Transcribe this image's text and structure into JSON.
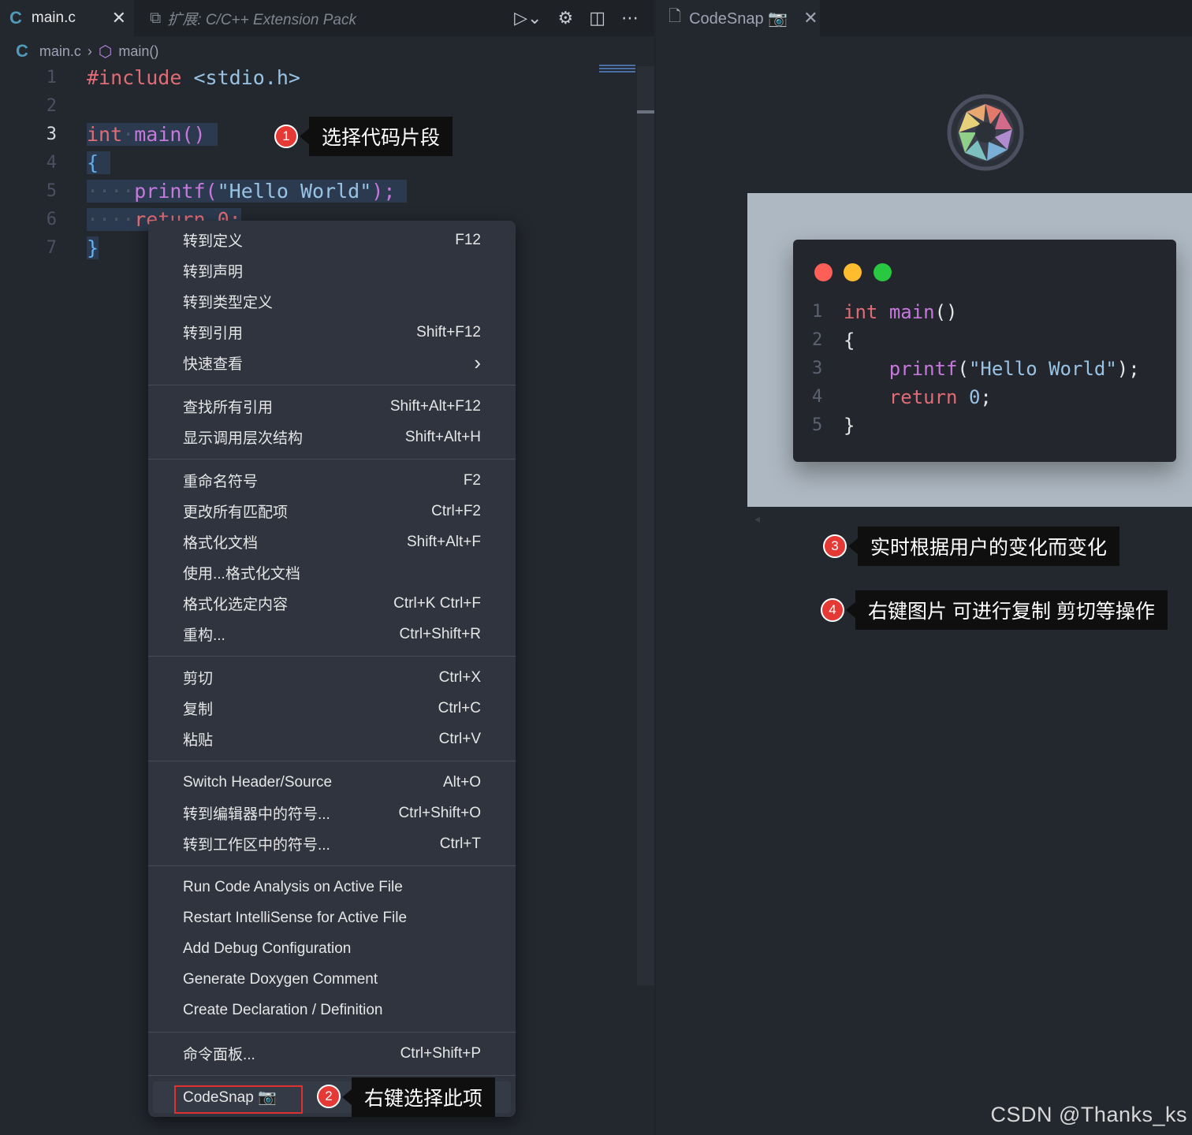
{
  "editor": {
    "tabs": [
      {
        "label": "main.c",
        "icon": "c-file-icon"
      },
      {
        "label": "扩展: C/C++ Extension Pack",
        "icon": "extensions-icon"
      }
    ],
    "breadcrumb": {
      "file": "main.c",
      "symbol": "main()"
    },
    "line_numbers": [
      "1",
      "2",
      "3",
      "4",
      "5",
      "6",
      "7"
    ],
    "code": {
      "l1_directive": "#include",
      "l1_header": "<stdio.h>",
      "l3_type": "int",
      "l3_name": "main()",
      "l4_open": "{",
      "l5_indent": "····",
      "l5_fn": "printf",
      "l5_paren_open": "(",
      "l5_str": "\"Hello World\"",
      "l5_end": ");",
      "l6_indent": "····",
      "l6_text": "return 0;",
      "l7_close": "}"
    }
  },
  "context_menu": {
    "groups": [
      [
        {
          "label": "转到定义",
          "shortcut": "F12"
        },
        {
          "label": "转到声明",
          "shortcut": ""
        },
        {
          "label": "转到类型定义",
          "shortcut": ""
        },
        {
          "label": "转到引用",
          "shortcut": "Shift+F12"
        },
        {
          "label": "快速查看",
          "shortcut": "›"
        }
      ],
      [
        {
          "label": "查找所有引用",
          "shortcut": "Shift+Alt+F12"
        },
        {
          "label": "显示调用层次结构",
          "shortcut": "Shift+Alt+H"
        }
      ],
      [
        {
          "label": "重命名符号",
          "shortcut": "F2"
        },
        {
          "label": "更改所有匹配项",
          "shortcut": "Ctrl+F2"
        },
        {
          "label": "格式化文档",
          "shortcut": "Shift+Alt+F"
        },
        {
          "label": "使用...格式化文档",
          "shortcut": ""
        },
        {
          "label": "格式化选定内容",
          "shortcut": "Ctrl+K Ctrl+F"
        },
        {
          "label": "重构...",
          "shortcut": "Ctrl+Shift+R"
        }
      ],
      [
        {
          "label": "剪切",
          "shortcut": "Ctrl+X"
        },
        {
          "label": "复制",
          "shortcut": "Ctrl+C"
        },
        {
          "label": "粘贴",
          "shortcut": "Ctrl+V"
        }
      ],
      [
        {
          "label": "Switch Header/Source",
          "shortcut": "Alt+O"
        },
        {
          "label": "转到编辑器中的符号...",
          "shortcut": "Ctrl+Shift+O"
        },
        {
          "label": "转到工作区中的符号...",
          "shortcut": "Ctrl+T"
        }
      ],
      [
        {
          "label": "Run Code Analysis on Active File",
          "shortcut": ""
        },
        {
          "label": "Restart IntelliSense for Active File",
          "shortcut": ""
        },
        {
          "label": "Add Debug Configuration",
          "shortcut": ""
        },
        {
          "label": "Generate Doxygen Comment",
          "shortcut": ""
        },
        {
          "label": "Create Declaration / Definition",
          "shortcut": ""
        }
      ],
      [
        {
          "label": "命令面板...",
          "shortcut": "Ctrl+Shift+P"
        }
      ]
    ],
    "codesnap_item": "CodeSnap 📷"
  },
  "annotations": [
    {
      "num": "1",
      "text": "选择代码片段"
    },
    {
      "num": "2",
      "text": "右键选择此项"
    },
    {
      "num": "3",
      "text": "实时根据用户的变化而变化"
    },
    {
      "num": "4",
      "text": "右键图片 可进行复制 剪切等操作"
    }
  ],
  "codesnap_panel": {
    "tab_label": "CodeSnap 📷",
    "snippet_line_numbers": [
      "1",
      "2",
      "3",
      "4",
      "5"
    ],
    "snippet": {
      "l1_type": "int",
      "l1_name": "main",
      "l1_parens": "()",
      "l2": "{",
      "l3_fn": "printf",
      "l3_open": "(",
      "l3_str": "\"Hello World\"",
      "l3_end": ");",
      "l4_kw": "return",
      "l4_num": "0",
      "l4_semi": ";",
      "l5": "}"
    },
    "window_dots": [
      "#ff5f57",
      "#febc2e",
      "#28c840"
    ]
  },
  "watermark": "CSDN @Thanks_ks",
  "colors": {
    "accent_red": "#e53935",
    "selection": "#2c3a4f",
    "editor_bg": "#23272e"
  }
}
